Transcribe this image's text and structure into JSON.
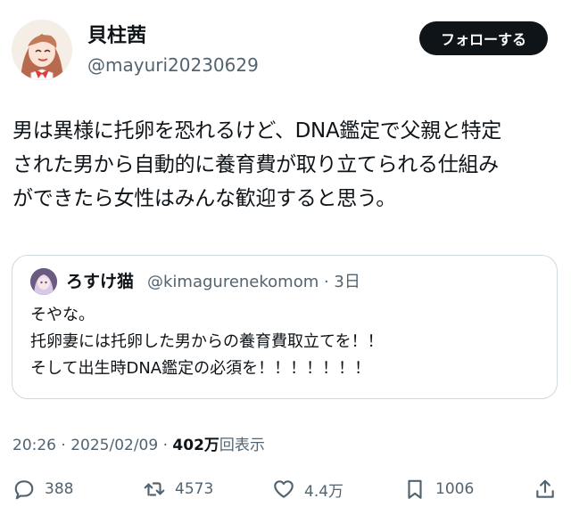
{
  "author": {
    "name": "貝柱茜",
    "handle": "@mayuri20230629",
    "avatar_icon": "anime-girl-avatar-icon"
  },
  "follow_label": "フォローする",
  "tweet_text": "男は異様に托卵を恐れるけど、DNA鑑定で父親と特定\nされた男から自動的に養育費が取り立てられる仕組み\nができたら女性はみんな歓迎すると思う。",
  "quoted": {
    "name": "ろすけ猫",
    "handle_time": "@kimagurenekomom · 3日",
    "text": "そやな。\n托卵妻には托卵した男からの養育費取立てを！！\nそして出生時DNA鑑定の必須を！！！！！！！"
  },
  "meta": {
    "time": "20:26 · 2025/02/09 · ",
    "views": "402万",
    "views_label": "回表示"
  },
  "actions": {
    "reply": "388",
    "retweet": "4573",
    "like": "4.4万",
    "bookmark": "1006"
  },
  "colors": {
    "text": "#0f1419",
    "secondary": "#536471",
    "border": "#cfd9de",
    "button": "#0f1419"
  }
}
